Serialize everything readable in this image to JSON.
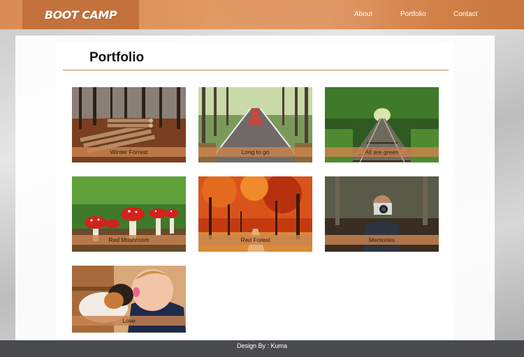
{
  "header": {
    "brand": "BOOT CAMP",
    "nav": [
      {
        "label": "About"
      },
      {
        "label": "Portfolio"
      },
      {
        "label": "Contact"
      }
    ]
  },
  "main": {
    "title": "Portfolio",
    "gallery": [
      {
        "caption": "Winter Forrest",
        "icon": "logs-in-forest-photo"
      },
      {
        "caption": "Long to go",
        "icon": "tree-lined-road-photo"
      },
      {
        "caption": "All are green",
        "icon": "railway-track-photo"
      },
      {
        "caption": "Red Mushroom",
        "icon": "red-mushroom-photo"
      },
      {
        "caption": "Red Forest",
        "icon": "autumn-forest-photo"
      },
      {
        "caption": "Memories",
        "icon": "child-with-camera-photo"
      },
      {
        "caption": "Love",
        "icon": "child-with-puppy-photo"
      }
    ]
  },
  "footer": {
    "credit": "Design By : Kuma"
  },
  "colors": {
    "accent": "#c9844f",
    "brand_bg": "#c4723c",
    "footer_bg": "#4a4b4e"
  }
}
